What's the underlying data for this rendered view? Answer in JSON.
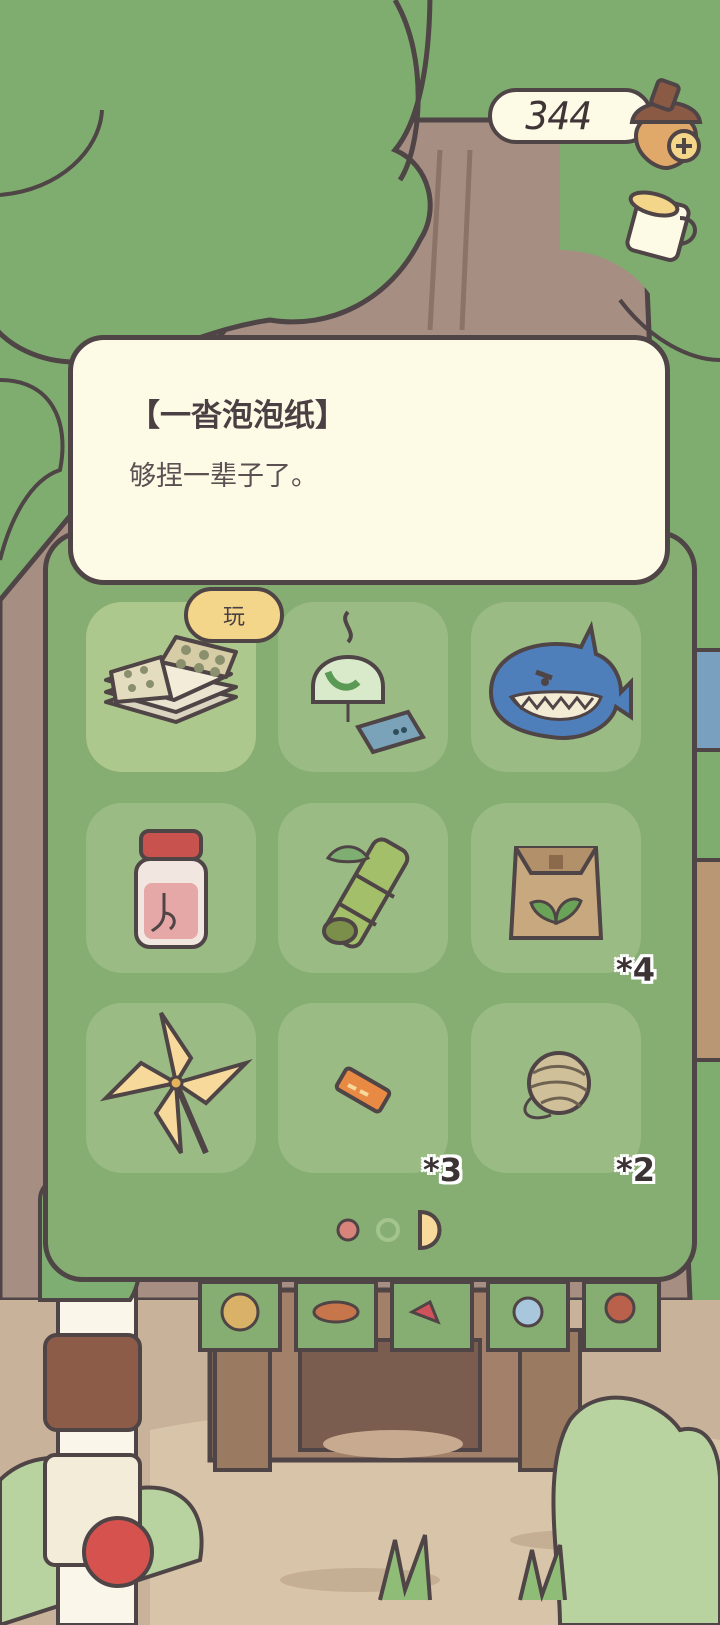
{
  "clover_count": "344",
  "item": {
    "title": "【一沓泡泡纸】",
    "description": "够捏一辈子了。"
  },
  "play_label": "玩",
  "inventory": [
    {
      "icon": "bubble-wrap-stack-icon",
      "count": ""
    },
    {
      "icon": "wind-chime-icon",
      "count": ""
    },
    {
      "icon": "shark-toy-icon",
      "count": ""
    },
    {
      "icon": "star-sand-bottle-icon",
      "count": ""
    },
    {
      "icon": "bamboo-tube-icon",
      "count": ""
    },
    {
      "icon": "seed-bag-icon",
      "count": "*4"
    },
    {
      "icon": "pinwheel-icon",
      "count": ""
    },
    {
      "icon": "candy-icon",
      "count": "*3"
    },
    {
      "icon": "yarn-ball-icon",
      "count": "*2"
    }
  ],
  "pagination": {
    "current_page": 1,
    "total_pages": 2
  },
  "colors": {
    "panel": "#86ad72",
    "slot": "#9bbb85",
    "paper": "#fdfae6",
    "outline": "#4f4446"
  }
}
